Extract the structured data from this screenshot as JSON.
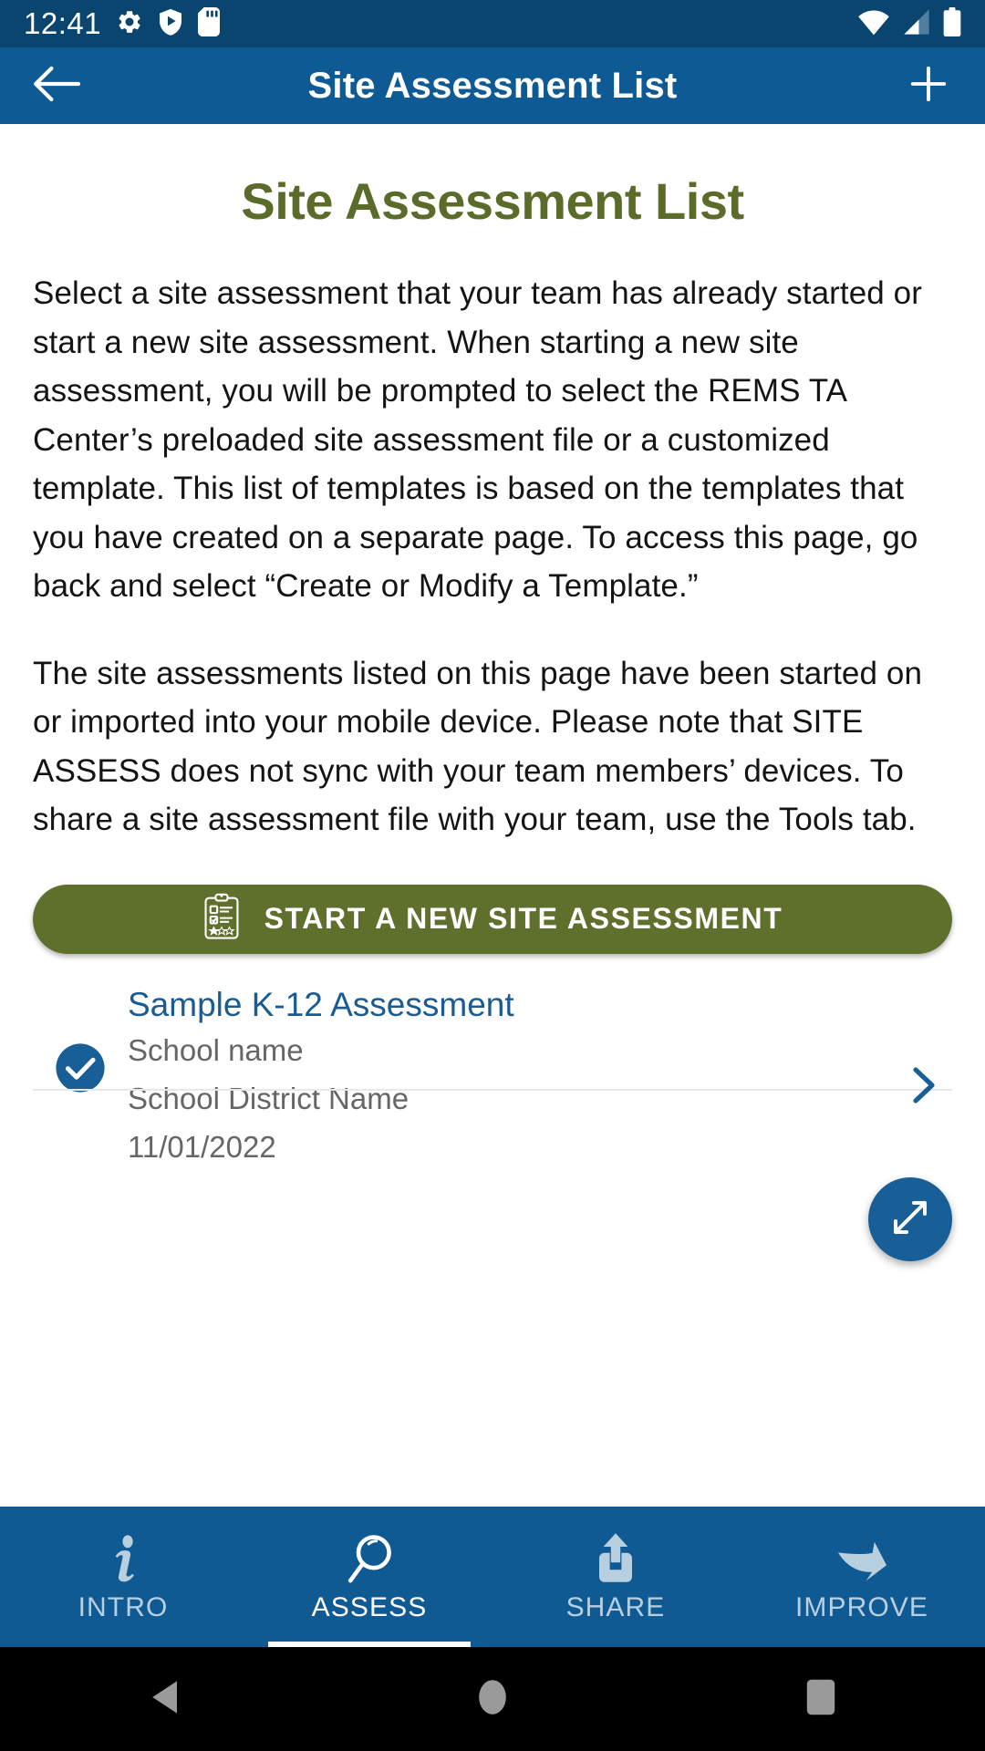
{
  "status_bar": {
    "time": "12:41",
    "icons_left": [
      "gear-icon",
      "shield-play-icon",
      "sd-card-icon"
    ],
    "icons_right": [
      "wifi-icon",
      "cellular-signal-icon",
      "battery-icon"
    ],
    "background_color": "#0a4570"
  },
  "app_bar": {
    "title": "Site Assessment List",
    "back_icon": "back-arrow-icon",
    "add_icon": "plus-icon",
    "background_color": "#0d5a94"
  },
  "main": {
    "page_title": "Site Assessment List",
    "page_title_color": "#5b6b2a",
    "paragraphs": [
      "Select a site assessment that your team has already started or start a new site assessment. When starting a new site assessment, you will be prompted to select the REMS TA Center’s preloaded site assessment file or a customized template. This list of templates is based on the templates that you have created on a separate page. To access this page, go back and select “Create or Modify a Template.”",
      "The site assessments listed on this page have been started on or imported into your mobile device. Please note that SITE ASSESS does not sync with your team members’ devices. To share a site assessment file with your team, use the Tools tab."
    ],
    "cta": {
      "label": "START A NEW SITE ASSESSMENT",
      "icon": "clipboard-checklist-icon",
      "background_color": "#5f6f2c"
    },
    "list": [
      {
        "title": "Sample K-12 Assessment",
        "school_name": "School name",
        "district_name": "School District Name",
        "date": "11/01/2022",
        "check_icon": "check-circle-icon",
        "chevron_icon": "chevron-right-icon",
        "selected": true
      }
    ],
    "fab": {
      "icon": "expand-diagonal-icon",
      "background_color": "#175f96"
    }
  },
  "tab_bar": {
    "background_color": "#105a94",
    "active_index": 1,
    "tabs": [
      {
        "label": "INTRO",
        "icon": "info-italic-icon"
      },
      {
        "label": "ASSESS",
        "icon": "magnifier-icon"
      },
      {
        "label": "SHARE",
        "icon": "share-upload-icon"
      },
      {
        "label": "IMPROVE",
        "icon": "curved-arrow-icon"
      }
    ]
  },
  "nav_bar": {
    "buttons": [
      {
        "icon": "android-back-icon"
      },
      {
        "icon": "android-home-icon"
      },
      {
        "icon": "android-recents-icon"
      }
    ]
  }
}
